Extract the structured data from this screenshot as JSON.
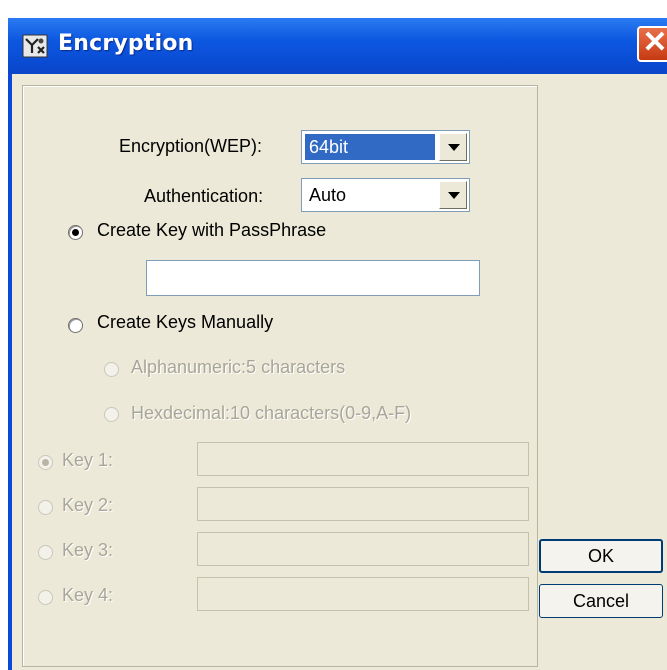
{
  "window": {
    "title": "Encryption",
    "icon": "wireless-network-icon",
    "close_glyph": "✕"
  },
  "encryption": {
    "label": "Encryption(WEP):",
    "selected": "64bit"
  },
  "authentication": {
    "label": "Authentication:",
    "selected": "Auto"
  },
  "passphrase": {
    "option_label": "Create Key with PassPhrase",
    "selected": true,
    "value": ""
  },
  "manual": {
    "option_label": "Create Keys Manually",
    "selected": false,
    "format_options": [
      "Alphanumeric:5 characters",
      "Hexdecimal:10 characters(0-9,A-F)"
    ]
  },
  "keys": [
    {
      "label": "Key 1:",
      "value": "",
      "selected": true
    },
    {
      "label": "Key 2:",
      "value": "",
      "selected": false
    },
    {
      "label": "Key 3:",
      "value": "",
      "selected": false
    },
    {
      "label": "Key 4:",
      "value": "",
      "selected": false
    }
  ],
  "buttons": {
    "ok": "OK",
    "cancel": "Cancel"
  },
  "colors": {
    "titlebar": "#0a4bd3",
    "dialog_face": "#ece9d8",
    "selection": "#316ac5",
    "close_button": "#d8572a"
  }
}
